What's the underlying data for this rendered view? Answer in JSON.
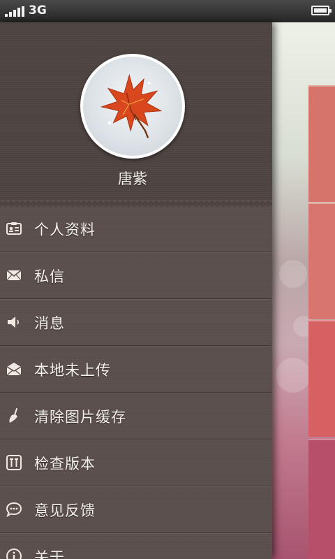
{
  "status_bar": {
    "network": "3G",
    "icons": [
      "signal-icon",
      "battery-icon"
    ]
  },
  "drawer": {
    "profile": {
      "username": "唐紫",
      "avatar": "maple-leaf-avatar"
    },
    "menu": [
      {
        "label": "个人资料",
        "icon": "id-card-icon"
      },
      {
        "label": "私信",
        "icon": "envelope-icon"
      },
      {
        "label": "消息",
        "icon": "speaker-icon"
      },
      {
        "label": "本地未上传",
        "icon": "outbox-envelope-icon"
      },
      {
        "label": "清除图片缓存",
        "icon": "broom-icon"
      },
      {
        "label": "检查版本",
        "icon": "version-check-icon"
      },
      {
        "label": "意见反馈",
        "icon": "speech-bubble-icon"
      },
      {
        "label": "关于",
        "icon": "info-icon"
      }
    ]
  },
  "colors": {
    "drawer_background": "#5b4f4c",
    "profile_background": "#4d4341",
    "menu_text": "#f4f0ea",
    "status_bar": "#262626"
  }
}
